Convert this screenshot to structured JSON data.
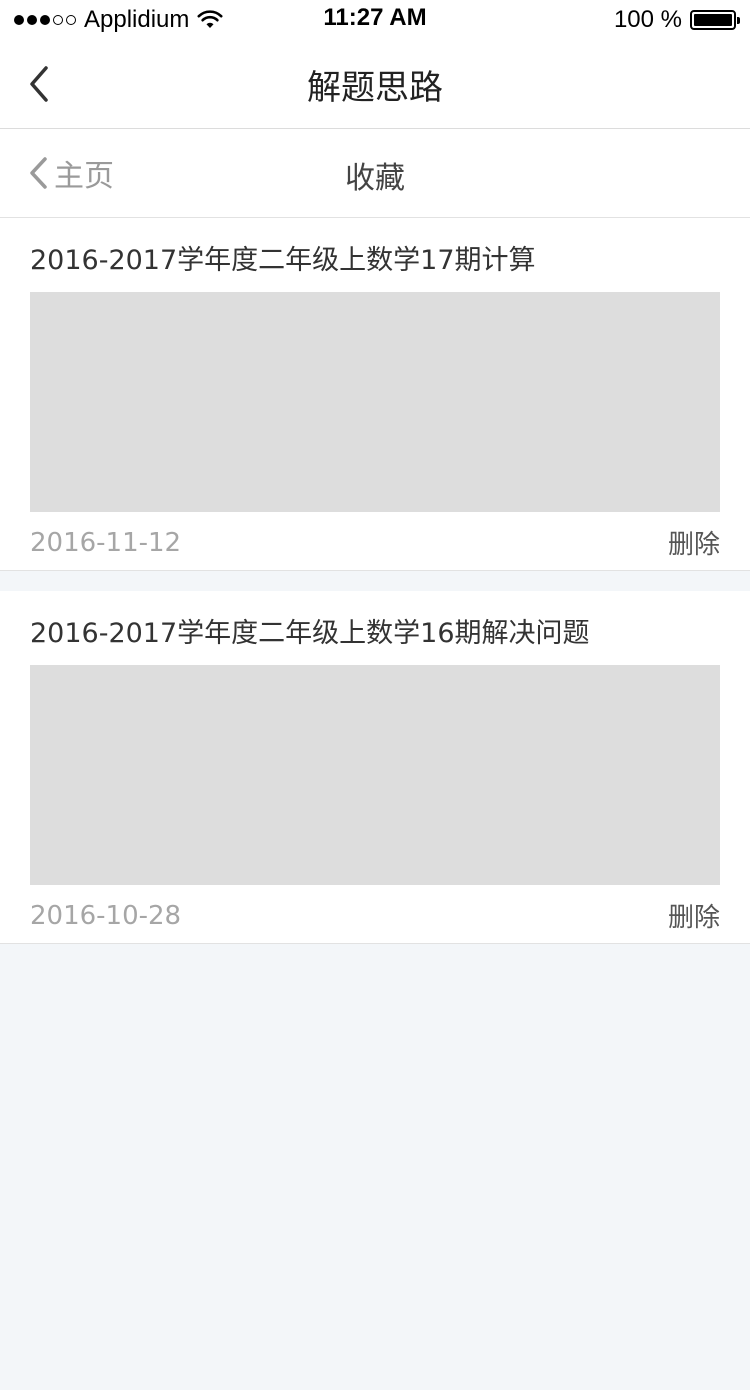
{
  "status_bar": {
    "carrier": "Applidium",
    "time": "11:27 AM",
    "battery_percent": "100 %",
    "signal_filled": 3,
    "signal_total": 5
  },
  "nav": {
    "title": "解题思路",
    "back_icon": "chevron-left-icon"
  },
  "sub_header": {
    "back_label": "主页",
    "title": "收藏"
  },
  "favorites": [
    {
      "title": "2016-2017学年度二年级上数学17期计算",
      "date": "2016-11-12",
      "delete_label": "删除"
    },
    {
      "title": "2016-2017学年度二年级上数学16期解决问题",
      "date": "2016-10-28",
      "delete_label": "删除"
    }
  ],
  "colors": {
    "background": "#f3f6f9",
    "card": "#ffffff",
    "image_placeholder": "#dddddd",
    "muted_text": "#a6a6a6"
  }
}
